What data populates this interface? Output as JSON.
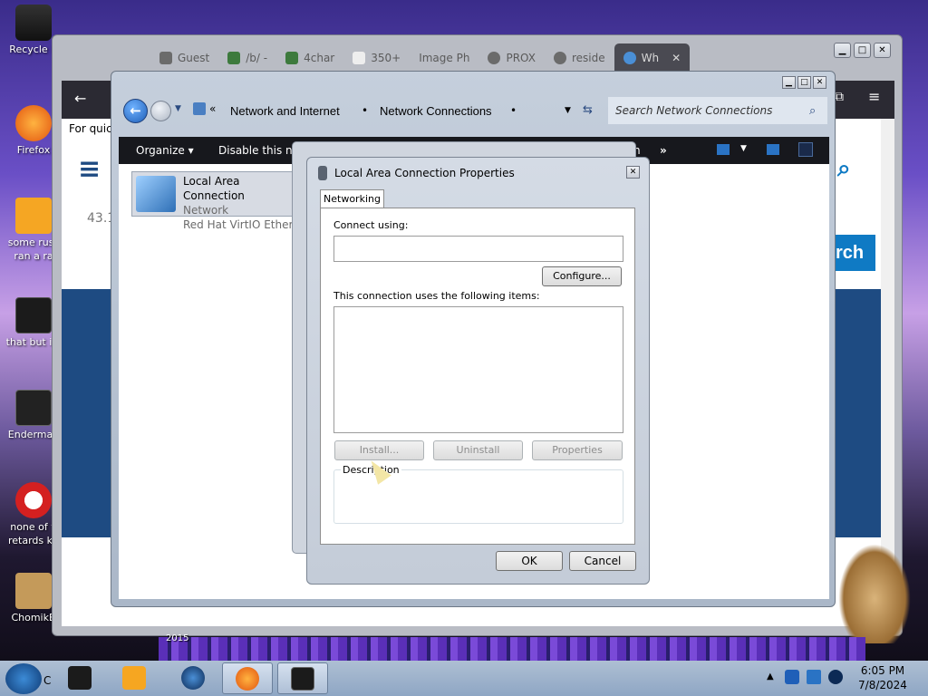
{
  "desktop": {
    "icons": [
      {
        "label": "Recycle B"
      },
      {
        "label": "Firefox"
      },
      {
        "label": "some russ ran a ra"
      },
      {
        "label": "that but its"
      },
      {
        "label": "Enderman"
      },
      {
        "label": "none of y retards kn"
      },
      {
        "label": "ChomikB"
      }
    ],
    "year_text": "2015"
  },
  "firefox": {
    "tabs": [
      {
        "label": "Guest"
      },
      {
        "label": "/b/ -"
      },
      {
        "label": "4char"
      },
      {
        "label": "350+"
      },
      {
        "label": "Image Ph"
      },
      {
        "label": "PROX"
      },
      {
        "label": "reside"
      },
      {
        "label": "Wh"
      }
    ],
    "page": {
      "quick_text": "For quick",
      "input_value": "43.1",
      "search_button": "rch"
    }
  },
  "explorer": {
    "breadcrumb": [
      "Network and Internet",
      "Network Connections"
    ],
    "search_placeholder": "Search Network Connections",
    "toolbar": {
      "organize": "Organize",
      "disable": "Disable this net",
      "h_text": "h"
    },
    "connection": {
      "name": "Local Area Connection",
      "status": "Network",
      "adapter": "Red Hat VirtIO Etherne"
    }
  },
  "properties_dialog": {
    "title": "Local Area Connection Properties",
    "tab": "Networking",
    "connect_using_label": "Connect using:",
    "adapter_value": "",
    "configure_button": "Configure...",
    "items_label": "This connection uses the following items:",
    "install_button": "Install...",
    "uninstall_button": "Uninstall",
    "properties_button": "Properties",
    "description_label": "Description",
    "ok_button": "OK",
    "cancel_button": "Cancel"
  },
  "taskbar": {
    "time": "6:05 PM",
    "date": "7/8/2024",
    "partial_label": "C"
  }
}
